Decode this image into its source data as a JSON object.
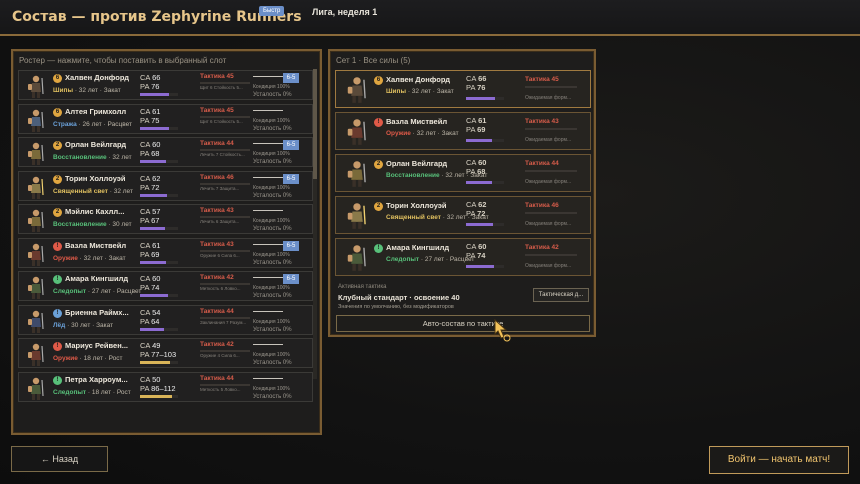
{
  "header": {
    "title": "Состав — против Zephyrine Runners",
    "badge": "Быстр",
    "week": "Лига, неделя 1"
  },
  "roster": {
    "head": "Ростер — нажмите, чтобы поставить в выбранный слот",
    "rows": [
      {
        "num": "6",
        "num_color": "#e0a640",
        "name": "Халвен Донфорд",
        "role": "Шипы",
        "role_color": "#e0c060",
        "info": " · 32 лет · Закат",
        "ca": "66",
        "pa": "76",
        "pa_fill": 0.76,
        "tactic": "Тактика 45",
        "tac_note": "Щит 6 Стойкость 5...",
        "cond": "Кондиция 100%",
        "fatigue": "Усталость 0%",
        "badge": "6-5",
        "icon": "warrior-icon"
      },
      {
        "num": "6",
        "num_color": "#e0a640",
        "name": "Алтея Гримхолл",
        "role": "Стража",
        "role_color": "#6aa0d8",
        "info": " · 26 лет · Расцвет",
        "ca": "61",
        "pa": "75",
        "pa_fill": 0.75,
        "tactic": "Тактика 45",
        "tac_note": "Щит 6 Стойкость 5...",
        "cond": "Кондиция 100%",
        "fatigue": "Усталость 0%",
        "badge": "",
        "icon": "guard-icon"
      },
      {
        "num": "2",
        "num_color": "#e0a640",
        "name": "Орлан Вейлгард",
        "role": "Восстановление",
        "role_color": "#58c07a",
        "info": " · 32 лет",
        "ca": "60",
        "pa": "68",
        "pa_fill": 0.68,
        "tactic": "Тактика 44",
        "tac_note": "Лечить 7 Стойкость...",
        "cond": "Кондиция 100%",
        "fatigue": "Усталость 0%",
        "badge": "6-5",
        "icon": "healer-icon"
      },
      {
        "num": "2",
        "num_color": "#e0a640",
        "name": "Торин Холлоуэй",
        "role": "Священный свет",
        "role_color": "#e0c060",
        "info": " · 32 лет",
        "ca": "62",
        "pa": "72",
        "pa_fill": 0.72,
        "tactic": "Тактика 46",
        "tac_note": "Лечить 7 Защита...",
        "cond": "Кондиция 100%",
        "fatigue": "Усталость 0%",
        "badge": "6-5",
        "icon": "priest-icon"
      },
      {
        "num": "2",
        "num_color": "#e0a640",
        "name": "Мэйлис Кахлл...",
        "role": "Восстановление",
        "role_color": "#58c07a",
        "info": " · 30 лет",
        "ca": "57",
        "pa": "67",
        "pa_fill": 0.67,
        "tactic": "Тактика 43",
        "tac_note": "Лечить 6 Защита...",
        "cond": "Кондиция 100%",
        "fatigue": "Усталость 0%",
        "badge": "",
        "icon": "healer-icon"
      },
      {
        "num": "!",
        "num_color": "#e05a48",
        "name": "Вазла Миствейл",
        "role": "Оружие",
        "role_color": "#e05a48",
        "info": " · 32 лет · Закат",
        "ca": "61",
        "pa": "69",
        "pa_fill": 0.69,
        "tactic": "Тактика 43",
        "tac_note": "Оружие 6 Сила 6...",
        "cond": "Кондиция 100%",
        "fatigue": "Усталость 0%",
        "badge": "6-5",
        "icon": "fighter-icon"
      },
      {
        "num": "!",
        "num_color": "#58c07a",
        "name": "Амара Кингшилд",
        "role": "Следопыт",
        "role_color": "#58c07a",
        "info": " · 27 лет · Расцвет",
        "ca": "60",
        "pa": "74",
        "pa_fill": 0.74,
        "tactic": "Тактика 42",
        "tac_note": "Меткость 6 Ловко...",
        "cond": "Кондиция 100%",
        "fatigue": "Усталость 0%",
        "badge": "6-5",
        "icon": "ranger-icon"
      },
      {
        "num": "!",
        "num_color": "#6aa0d8",
        "name": "Бриенна Раймх...",
        "role": "Лёд",
        "role_color": "#6aa0d8",
        "info": " · 30 лет · Закат",
        "ca": "54",
        "pa": "64",
        "pa_fill": 0.64,
        "tactic": "Тактика 44",
        "tac_note": "Заклинания 7 Разум...",
        "cond": "Кондиция 100%",
        "fatigue": "Усталость 0%",
        "badge": "",
        "icon": "mage-icon"
      },
      {
        "num": "!",
        "num_color": "#e05a48",
        "name": "Мариус Рейвен...",
        "role": "Оружие",
        "role_color": "#e05a48",
        "info": " · 18 лет · Рост",
        "ca": "49",
        "pa": "77–103",
        "pa_fill": 0.8,
        "tactic": "Тактика 42",
        "tac_note": "Оружие 4 Сила 6...",
        "cond": "Кондиция 100%",
        "fatigue": "Усталость 0%",
        "badge": "",
        "icon": "fighter-icon"
      },
      {
        "num": "!",
        "num_color": "#58c07a",
        "name": "Петра Харроум...",
        "role": "Следопыт",
        "role_color": "#58c07a",
        "info": " · 18 лет · Рост",
        "ca": "50",
        "pa": "86–112",
        "pa_fill": 0.85,
        "tactic": "Тактика 44",
        "tac_note": "Меткость 5 Ловко...",
        "cond": "Кондиция 100%",
        "fatigue": "Усталость 0%",
        "badge": "",
        "icon": "ranger-icon"
      }
    ]
  },
  "lineup": {
    "head": "Сет 1 · Все силы (5)",
    "rows": [
      {
        "num": "6",
        "num_color": "#e0a640",
        "name": "Халвен Донфорд",
        "role": "Шипы",
        "role_color": "#e0c060",
        "info": " · 32 лет · Закат",
        "ca": "66",
        "pa": "76",
        "pa_fill": 0.76,
        "tactic": "Тактика 45",
        "tac_note": "Ожидаемая форм...",
        "icon": "warrior-icon"
      },
      {
        "num": "!",
        "num_color": "#e05a48",
        "name": "Вазла Миствейл",
        "role": "Оружие",
        "role_color": "#e05a48",
        "info": " · 32 лет · Закат",
        "ca": "61",
        "pa": "69",
        "pa_fill": 0.69,
        "tactic": "Тактика 43",
        "tac_note": "Ожидаемая форм...",
        "icon": "fighter-icon"
      },
      {
        "num": "2",
        "num_color": "#e0a640",
        "name": "Орлан Вейлгард",
        "role": "Восстановление",
        "role_color": "#58c07a",
        "info": " · 32 лет · Закат",
        "ca": "60",
        "pa": "68",
        "pa_fill": 0.68,
        "tactic": "Тактика 44",
        "tac_note": "Ожидаемая форм...",
        "icon": "healer-icon"
      },
      {
        "num": "2",
        "num_color": "#e0a640",
        "name": "Торин Холлоуэй",
        "role": "Священный свет",
        "role_color": "#e0c060",
        "info": " · 32 лет · Закат",
        "ca": "62",
        "pa": "72",
        "pa_fill": 0.72,
        "tactic": "Тактика 46",
        "tac_note": "Ожидаемая форм...",
        "icon": "priest-icon"
      },
      {
        "num": "!",
        "num_color": "#58c07a",
        "name": "Амара Кингшилд",
        "role": "Следопыт",
        "role_color": "#58c07a",
        "info": " · 27 лет · Расцвет",
        "ca": "60",
        "pa": "74",
        "pa_fill": 0.74,
        "tactic": "Тактика 42",
        "tac_note": "Ожидаемая форм...",
        "icon": "ranger-icon"
      }
    ],
    "active_label": "Активная тактика",
    "active_value": "Клубный стандарт · освоение 40",
    "active_desc": "Значения по умолчанию, без модификаторов",
    "tactics_button": "Тактическая д...",
    "auto_button": "Авто-состав по тактике"
  },
  "footer": {
    "back": "← Назад",
    "start": "Войти — начать матч!"
  }
}
